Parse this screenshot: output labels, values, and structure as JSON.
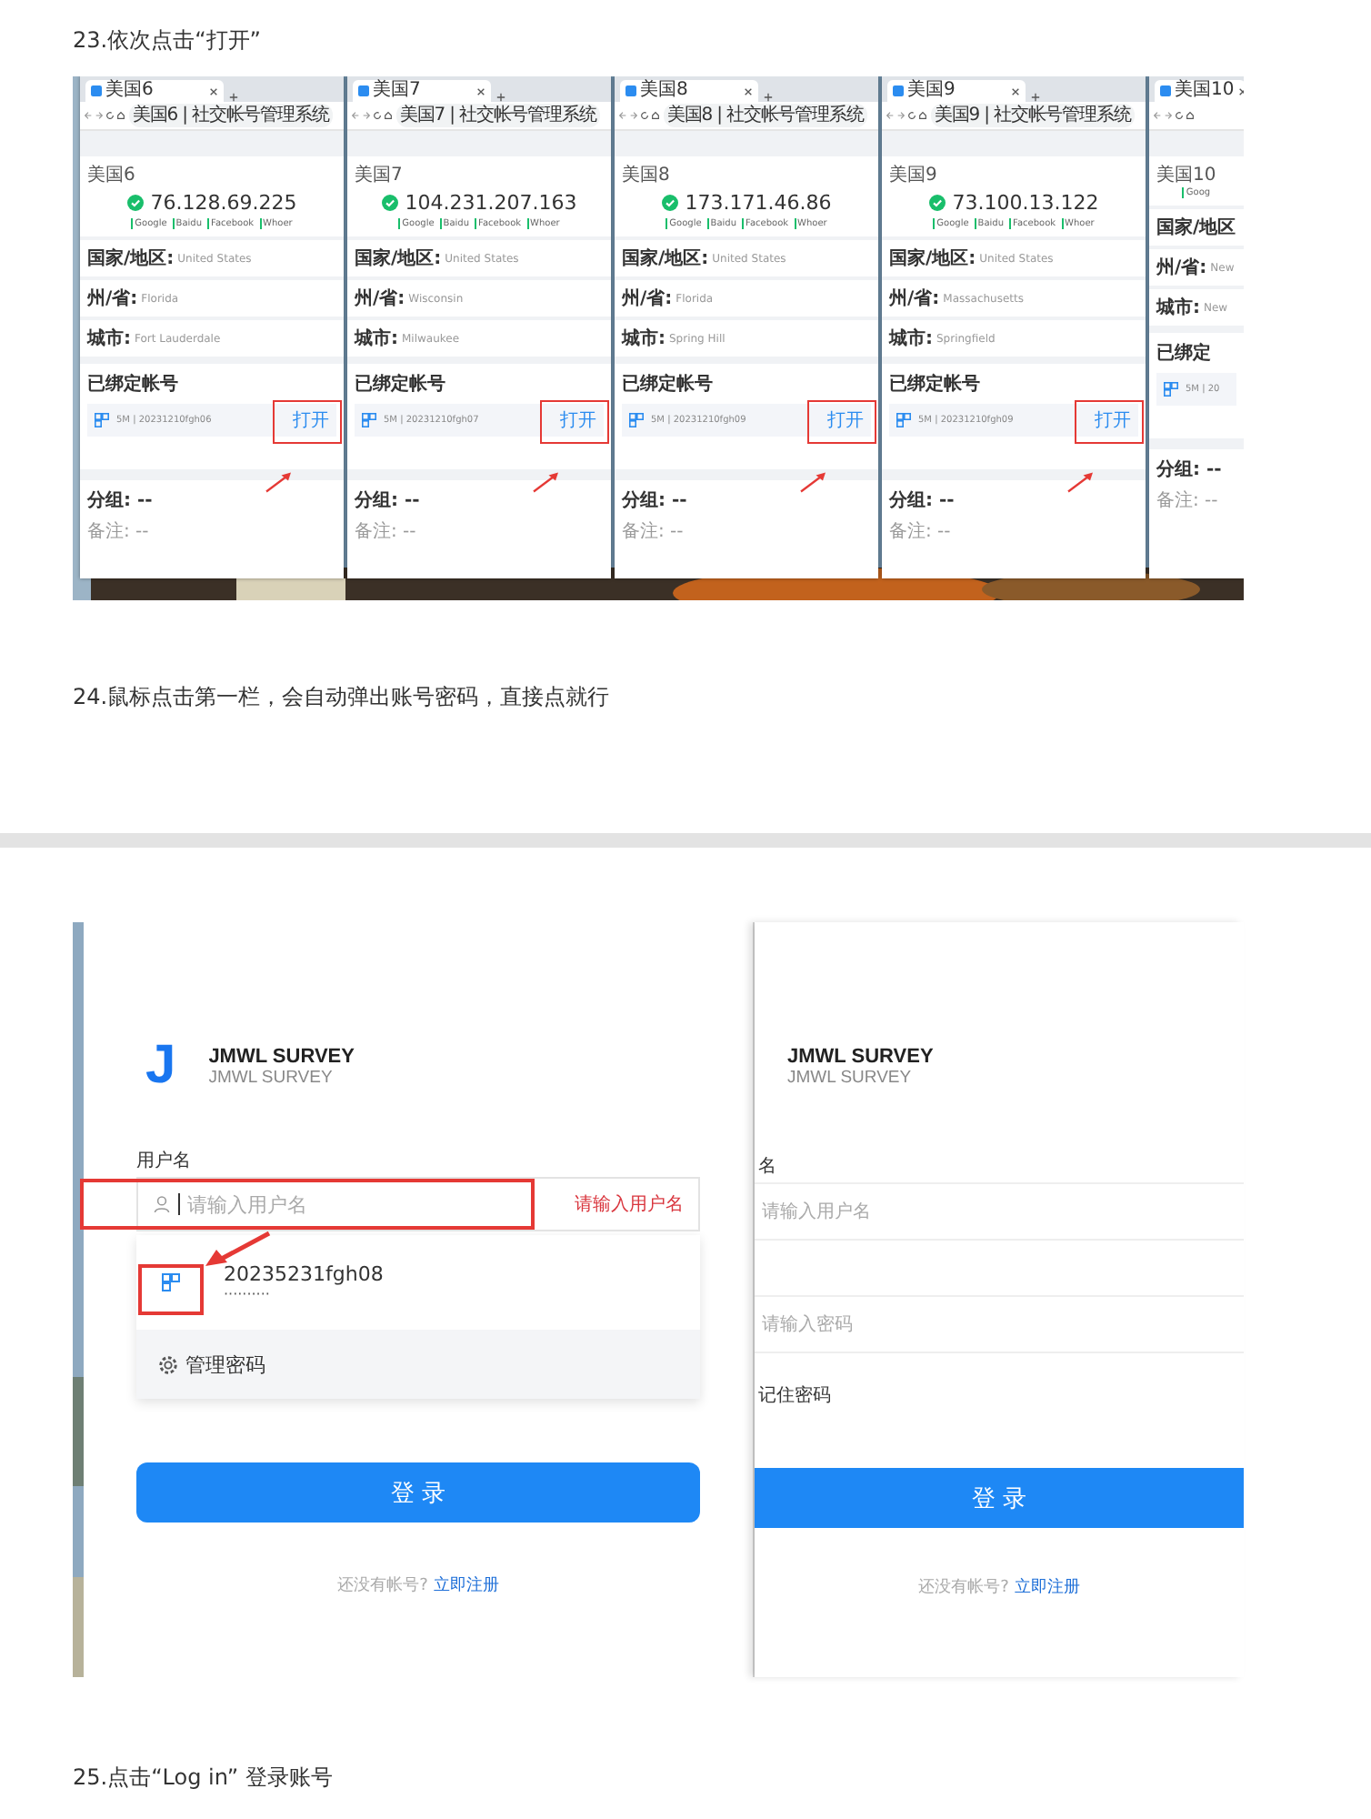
{
  "step_23": {
    "text": "23.依次点击“打开”"
  },
  "browser_windows": [
    {
      "tab_title": "美国6",
      "address": "美国6 | 社交帐号管理系统",
      "profile": "美国6",
      "ip": "76.128.69.225",
      "checks": [
        "Google",
        "Baidu",
        "Facebook",
        "Whoer"
      ],
      "fields": [
        {
          "label": "国家/地区:",
          "value": "United States"
        },
        {
          "label": "州/省:",
          "value": "Florida"
        },
        {
          "label": "城市:",
          "value": "Fort Lauderdale"
        }
      ],
      "bound_title": "已绑定帐号",
      "account": "5M | 20231210fgh06",
      "open_label": "打开",
      "group": "分组: --",
      "note": "备注: --",
      "annotated": true
    },
    {
      "tab_title": "美国7",
      "address": "美国7 | 社交帐号管理系统",
      "profile": "美国7",
      "ip": "104.231.207.163",
      "checks": [
        "Google",
        "Baidu",
        "Facebook",
        "Whoer"
      ],
      "fields": [
        {
          "label": "国家/地区:",
          "value": "United States"
        },
        {
          "label": "州/省:",
          "value": "Wisconsin"
        },
        {
          "label": "城市:",
          "value": "Milwaukee"
        }
      ],
      "bound_title": "已绑定帐号",
      "account": "5M | 20231210fgh07",
      "open_label": "打开",
      "group": "分组: --",
      "note": "备注: --",
      "annotated": true
    },
    {
      "tab_title": "美国8",
      "address": "美国8 | 社交帐号管理系统",
      "profile": "美国8",
      "ip": "173.171.46.86",
      "checks": [
        "Google",
        "Baidu",
        "Facebook",
        "Whoer"
      ],
      "fields": [
        {
          "label": "国家/地区:",
          "value": "United States"
        },
        {
          "label": "州/省:",
          "value": "Florida"
        },
        {
          "label": "城市:",
          "value": "Spring Hill"
        }
      ],
      "bound_title": "已绑定帐号",
      "account": "5M | 20231210fgh09",
      "open_label": "打开",
      "group": "分组: --",
      "note": "备注: --",
      "annotated": true
    },
    {
      "tab_title": "美国9",
      "address": "美国9 | 社交帐号管理系统",
      "profile": "美国9",
      "ip": "73.100.13.122",
      "checks": [
        "Google",
        "Baidu",
        "Facebook",
        "Whoer"
      ],
      "fields": [
        {
          "label": "国家/地区:",
          "value": "United States"
        },
        {
          "label": "州/省:",
          "value": "Massachusetts"
        },
        {
          "label": "城市:",
          "value": "Springfield"
        }
      ],
      "bound_title": "已绑定帐号",
      "account": "5M | 20231210fgh09",
      "open_label": "打开",
      "group": "分组: --",
      "note": "备注: --",
      "annotated": true
    },
    {
      "tab_title": "美国10",
      "profile": "美国10",
      "checks": [
        "Goog"
      ],
      "fields": [
        {
          "label": "国家/地区"
        },
        {
          "label": "州/省:",
          "value": "New"
        },
        {
          "label": "城市:",
          "value": "New"
        }
      ],
      "bound_title": "已绑定",
      "account": "5M | 20",
      "group": "分组: --",
      "note": "备注: --",
      "annotated": false
    }
  ],
  "step_24": {
    "text": "24.鼠标点击第一栏，会自动弹出账号密码，直接点就行"
  },
  "login_left": {
    "logo": "J",
    "title": "JMWL SURVEY",
    "subtitle": "JMWL SURVEY",
    "username_label": "用户名",
    "username_placeholder": "请输入用户名",
    "username_error": "请输入用户名",
    "saved_account": "20235231fgh08",
    "saved_password": "··········",
    "manage_passwords": "管理密码",
    "login_button": "登 录",
    "footer_text": "还没有帐号?",
    "register_link": "立即注册"
  },
  "login_right": {
    "title": "JMWL SURVEY",
    "subtitle": "JMWL SURVEY",
    "username_label": "名",
    "username_placeholder": "请输入用户名",
    "password_placeholder": "请输入密码",
    "remember": "记住密码",
    "login_button": "登 录",
    "footer_text": "还没有帐号?",
    "register_link": "立即注册"
  },
  "step_25": {
    "text": "25.点击“Log in” 登录账号"
  }
}
